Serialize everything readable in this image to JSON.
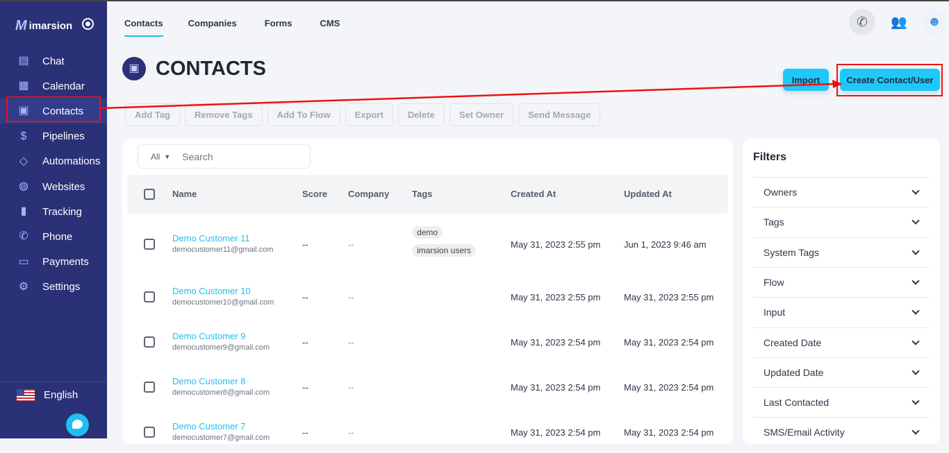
{
  "brand": "imarsion",
  "nav": [
    {
      "label": "Chat",
      "icon": "chat-icon",
      "g": "▤"
    },
    {
      "label": "Calendar",
      "icon": "calendar-icon",
      "g": "▦"
    },
    {
      "label": "Contacts",
      "icon": "contacts-icon",
      "g": "▣"
    },
    {
      "label": "Pipelines",
      "icon": "dollar-icon",
      "g": "$"
    },
    {
      "label": "Automations",
      "icon": "automation-icon",
      "g": "◇"
    },
    {
      "label": "Websites",
      "icon": "globe-icon",
      "g": "◍"
    },
    {
      "label": "Tracking",
      "icon": "bar-chart-icon",
      "g": "▮"
    },
    {
      "label": "Phone",
      "icon": "phone-icon",
      "g": "✆"
    },
    {
      "label": "Payments",
      "icon": "card-icon",
      "g": "▭"
    },
    {
      "label": "Settings",
      "icon": "gear-icon",
      "g": "⚙"
    }
  ],
  "language": "English",
  "tabs": [
    "Contacts",
    "Companies",
    "Forms",
    "CMS"
  ],
  "page_title": "CONTACTS",
  "import_label": "Import",
  "create_label": "Create Contact/User",
  "actions": [
    "Add Tag",
    "Remove Tags",
    "Add To Flow",
    "Export",
    "Delete",
    "Set Owner",
    "Send Message"
  ],
  "search": {
    "filter": "All",
    "placeholder": "Search"
  },
  "columns": [
    "Name",
    "Score",
    "Company",
    "Tags",
    "Created At",
    "Updated At"
  ],
  "rows": [
    {
      "name": "Demo Customer 11",
      "email": "democustomer11@gmail.com",
      "score": "--",
      "company": "--",
      "tags": [
        "demo",
        "imarsion users"
      ],
      "created": "May 31, 2023 2:55 pm",
      "updated": "Jun 1, 2023 9:46 am"
    },
    {
      "name": "Demo Customer 10",
      "email": "democustomer10@gmail.com",
      "score": "--",
      "company": "--",
      "tags": [],
      "created": "May 31, 2023 2:55 pm",
      "updated": "May 31, 2023 2:55 pm"
    },
    {
      "name": "Demo Customer 9",
      "email": "democustomer9@gmail.com",
      "score": "--",
      "company": "--",
      "tags": [],
      "created": "May 31, 2023 2:54 pm",
      "updated": "May 31, 2023 2:54 pm"
    },
    {
      "name": "Demo Customer 8",
      "email": "democustomer8@gmail.com",
      "score": "--",
      "company": "--",
      "tags": [],
      "created": "May 31, 2023 2:54 pm",
      "updated": "May 31, 2023 2:54 pm"
    },
    {
      "name": "Demo Customer 7",
      "email": "democustomer7@gmail.com",
      "score": "--",
      "company": "--",
      "tags": [],
      "created": "May 31, 2023 2:54 pm",
      "updated": "May 31, 2023 2:54 pm"
    }
  ],
  "filters_title": "Filters",
  "filters": [
    "Owners",
    "Tags",
    "System Tags",
    "Flow",
    "Input",
    "Created Date",
    "Updated Date",
    "Last Contacted",
    "SMS/Email Activity"
  ]
}
